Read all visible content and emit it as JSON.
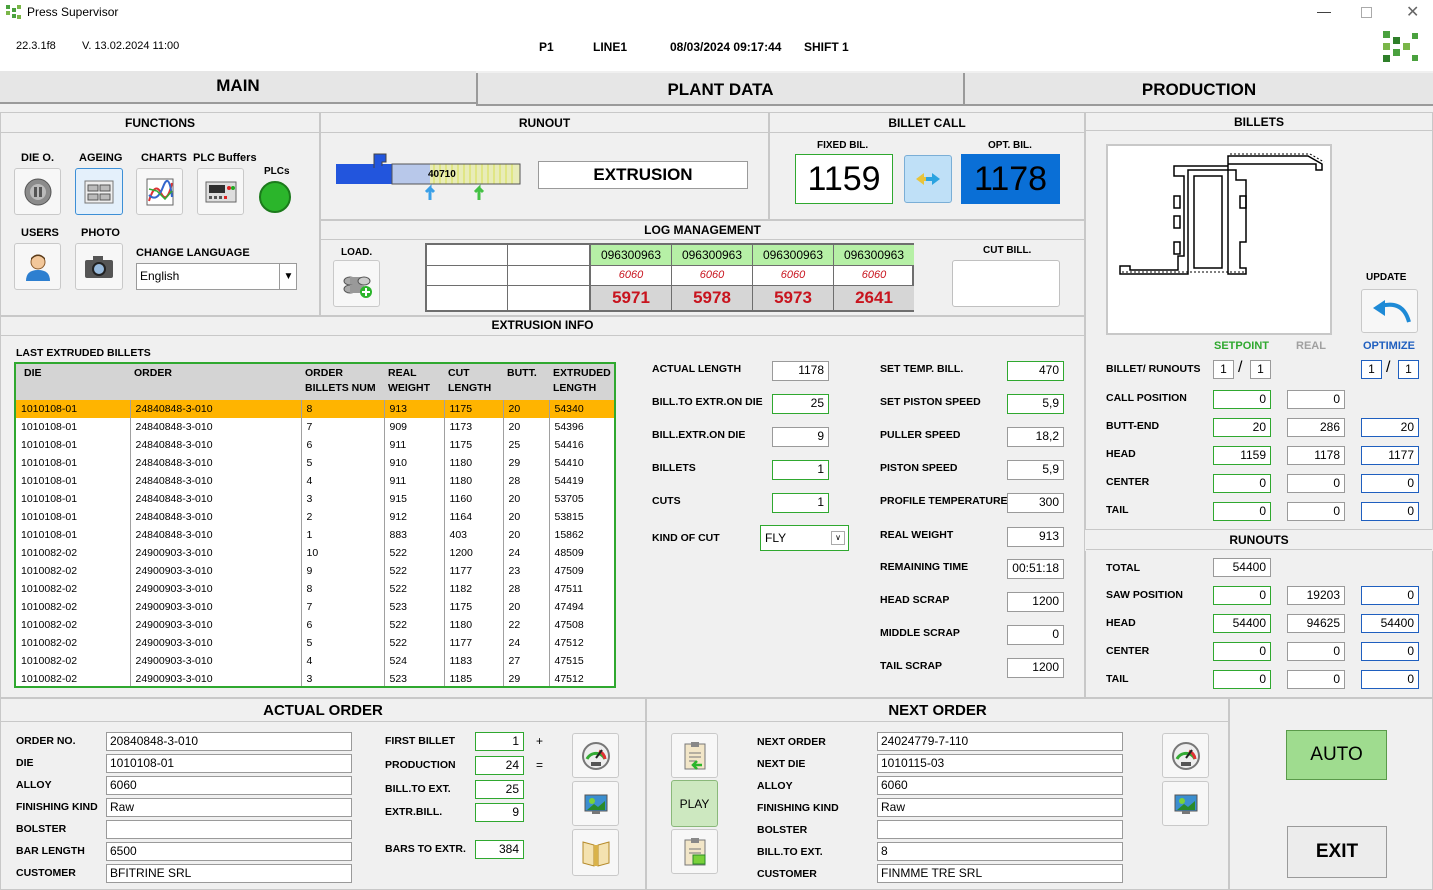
{
  "window": {
    "title": "Press Supervisor"
  },
  "header": {
    "build": "22.3.1f8",
    "version": "V. 13.02.2024 11:00",
    "press": "P1",
    "line": "LINE1",
    "datetime": "08/03/2024 09:17:44",
    "shift": "SHIFT 1"
  },
  "tabs": [
    {
      "label": "MAIN"
    },
    {
      "label": "PLANT DATA"
    },
    {
      "label": "PRODUCTION"
    }
  ],
  "functions": {
    "title": "FUNCTIONS",
    "die": "DIE O.",
    "ageing": "AGEING",
    "charts": "CHARTS",
    "plc_buffers": "PLC Buffers",
    "plcs": "PLCs",
    "users": "USERS",
    "photo": "PHOTO",
    "change_language": "CHANGE LANGUAGE",
    "language": "English"
  },
  "runout": {
    "title": "RUNOUT",
    "position": "40710",
    "status": "EXTRUSION"
  },
  "billet_call": {
    "title": "BILLET CALL",
    "fixed_label": "FIXED BIL.",
    "fixed": "1159",
    "opt_label": "OPT. BIL.",
    "opt": "1178"
  },
  "log_management": {
    "title": "LOG MANAGEMENT",
    "load": "LOAD.",
    "cut_bill": "CUT BILL.",
    "logs": [
      {
        "id": "096300963",
        "alloy": "6060",
        "length": "5971"
      },
      {
        "id": "096300963",
        "alloy": "6060",
        "length": "5978"
      },
      {
        "id": "096300963",
        "alloy": "6060",
        "length": "5973"
      },
      {
        "id": "096300963",
        "alloy": "6060",
        "length": "2641"
      }
    ]
  },
  "billets_panel": {
    "title": "BILLETS",
    "update": "UPDATE",
    "setpoint": "SETPOINT",
    "real": "REAL",
    "optimize": "OPTIMIZE",
    "billet_runouts": {
      "label": "BILLET/ RUNOUTS",
      "sp_a": "1",
      "sp_b": "1",
      "opt_a": "1",
      "opt_b": "1"
    },
    "rows": [
      {
        "label": "CALL POSITION",
        "sp": "0",
        "real": "0",
        "opt": ""
      },
      {
        "label": "BUTT-END",
        "sp": "20",
        "real": "286",
        "opt": "20"
      },
      {
        "label": "HEAD",
        "sp": "1159",
        "real": "1178",
        "opt": "1177"
      },
      {
        "label": "CENTER",
        "sp": "0",
        "real": "0",
        "opt": "0"
      },
      {
        "label": "TAIL",
        "sp": "0",
        "real": "0",
        "opt": "0"
      }
    ]
  },
  "runouts": {
    "title": "RUNOUTS",
    "total_label": "TOTAL",
    "total": "54400",
    "rows": [
      {
        "label": "SAW POSITION",
        "sp": "0",
        "real": "19203",
        "opt": "0"
      },
      {
        "label": "HEAD",
        "sp": "54400",
        "real": "94625",
        "opt": "54400"
      },
      {
        "label": "CENTER",
        "sp": "0",
        "real": "0",
        "opt": "0"
      },
      {
        "label": "TAIL",
        "sp": "0",
        "real": "0",
        "opt": "0"
      }
    ]
  },
  "extrusion_info": {
    "title": "EXTRUSION INFO",
    "last_billets": "LAST EXTRUDED BILLETS",
    "columns": [
      "DIE",
      "ORDER",
      "ORDER BILLETS NUM",
      "REAL WEIGHT",
      "CUT LENGTH",
      "BUTT.",
      "EXTRUDED LENGTH"
    ],
    "rows": [
      [
        "1010108-01",
        "24840848-3-010",
        "8",
        "913",
        "1175",
        "20",
        "54340"
      ],
      [
        "1010108-01",
        "24840848-3-010",
        "7",
        "909",
        "1173",
        "20",
        "54396"
      ],
      [
        "1010108-01",
        "24840848-3-010",
        "6",
        "911",
        "1175",
        "25",
        "54416"
      ],
      [
        "1010108-01",
        "24840848-3-010",
        "5",
        "910",
        "1180",
        "29",
        "54410"
      ],
      [
        "1010108-01",
        "24840848-3-010",
        "4",
        "911",
        "1180",
        "28",
        "54419"
      ],
      [
        "1010108-01",
        "24840848-3-010",
        "3",
        "915",
        "1160",
        "20",
        "53705"
      ],
      [
        "1010108-01",
        "24840848-3-010",
        "2",
        "912",
        "1164",
        "20",
        "53815"
      ],
      [
        "1010108-01",
        "24840848-3-010",
        "1",
        "883",
        "403",
        "20",
        "15862"
      ],
      [
        "1010082-02",
        "24900903-3-010",
        "10",
        "522",
        "1200",
        "24",
        "48509"
      ],
      [
        "1010082-02",
        "24900903-3-010",
        "9",
        "522",
        "1177",
        "23",
        "47509"
      ],
      [
        "1010082-02",
        "24900903-3-010",
        "8",
        "522",
        "1182",
        "28",
        "47511"
      ],
      [
        "1010082-02",
        "24900903-3-010",
        "7",
        "523",
        "1175",
        "20",
        "47494"
      ],
      [
        "1010082-02",
        "24900903-3-010",
        "6",
        "522",
        "1180",
        "22",
        "47508"
      ],
      [
        "1010082-02",
        "24900903-3-010",
        "5",
        "522",
        "1177",
        "24",
        "47512"
      ],
      [
        "1010082-02",
        "24900903-3-010",
        "4",
        "524",
        "1183",
        "27",
        "47515"
      ],
      [
        "1010082-02",
        "24900903-3-010",
        "3",
        "523",
        "1185",
        "29",
        "47512"
      ]
    ],
    "left_fields": [
      {
        "label": "ACTUAL LENGTH",
        "value": "1178",
        "g": false
      },
      {
        "label": "BILL.TO EXTR.ON DIE",
        "value": "25",
        "g": true
      },
      {
        "label": "BILL.EXTR.ON DIE",
        "value": "9",
        "g": false
      },
      {
        "label": "BILLETS",
        "value": "1",
        "g": true
      },
      {
        "label": "CUTS",
        "value": "1",
        "g": true
      }
    ],
    "kind_of_cut_label": "KIND OF CUT",
    "kind_of_cut": "FLY",
    "right_fields": [
      {
        "label": "SET TEMP. BILL.",
        "value": "470",
        "g": true
      },
      {
        "label": "SET PISTON SPEED",
        "value": "5,9",
        "g": true
      },
      {
        "label": "PULLER SPEED",
        "value": "18,2",
        "g": false
      },
      {
        "label": "PISTON SPEED",
        "value": "5,9",
        "g": false
      },
      {
        "label": "PROFILE TEMPERATURE",
        "value": "300",
        "g": false
      },
      {
        "label": "REAL WEIGHT",
        "value": "913",
        "g": false
      },
      {
        "label": "REMAINING TIME",
        "value": "00:51:18",
        "g": false
      },
      {
        "label": "HEAD SCRAP",
        "value": "1200",
        "g": false
      },
      {
        "label": "MIDDLE SCRAP",
        "value": "0",
        "g": false
      },
      {
        "label": "TAIL SCRAP",
        "value": "1200",
        "g": false
      }
    ]
  },
  "actual_order": {
    "title": "ACTUAL ORDER",
    "fields": [
      {
        "label": "ORDER NO.",
        "value": "20840848-3-010"
      },
      {
        "label": "DIE",
        "value": "1010108-01"
      },
      {
        "label": "ALLOY",
        "value": "6060"
      },
      {
        "label": "FINISHING KIND",
        "value": "Raw"
      },
      {
        "label": "BOLSTER",
        "value": ""
      },
      {
        "label": "BAR LENGTH",
        "value": "6500"
      },
      {
        "label": "CUSTOMER",
        "value": "BFITRINE  SRL"
      }
    ],
    "counts": [
      {
        "label": "FIRST BILLET",
        "value": "1",
        "op": "+"
      },
      {
        "label": "PRODUCTION",
        "value": "24",
        "op": "="
      },
      {
        "label": "BILL.TO EXT.",
        "value": "25",
        "op": ""
      },
      {
        "label": "EXTR.BILL.",
        "value": "9",
        "op": ""
      },
      {
        "label": "BARS TO EXTR.",
        "value": "384",
        "op": ""
      }
    ]
  },
  "next_order": {
    "title": "NEXT ORDER",
    "play": "PLAY",
    "fields": [
      {
        "label": "NEXT ORDER",
        "value": "24024779-7-110"
      },
      {
        "label": "NEXT DIE",
        "value": "1010115-03"
      },
      {
        "label": "ALLOY",
        "value": "6060"
      },
      {
        "label": "FINISHING KIND",
        "value": "Raw"
      },
      {
        "label": "BOLSTER",
        "value": ""
      },
      {
        "label": "BILL.TO EXT.",
        "value": "8"
      },
      {
        "label": "CUSTOMER",
        "value": "FINMME  TRE SRL"
      }
    ]
  },
  "controls": {
    "auto": "AUTO",
    "exit": "EXIT"
  },
  "colors": {
    "highlight": "#ffb400",
    "blue_value": "#0a6fd6",
    "green_border": "#2fa82f",
    "plc_ok": "#2bb52b",
    "auto_bg": "#9fdc8f",
    "log_header_bg": "#b6f0a6",
    "log_bottom_bg": "#d6d6d6",
    "red_text": "#c8141e"
  }
}
